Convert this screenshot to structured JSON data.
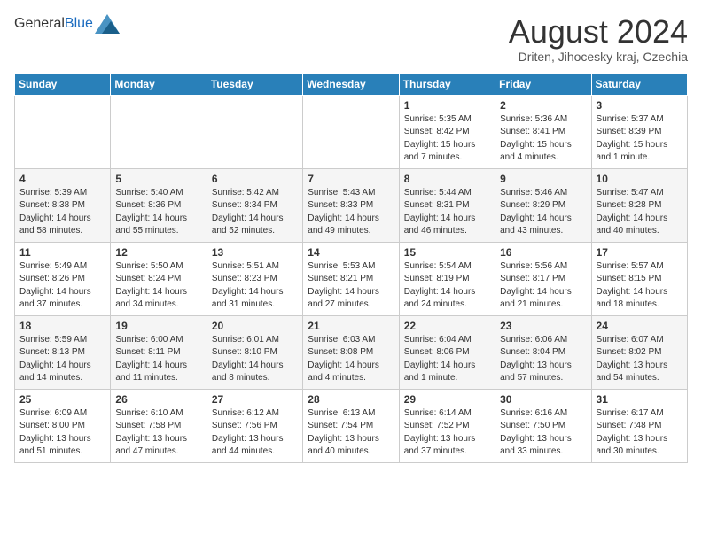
{
  "header": {
    "logo_general": "General",
    "logo_blue": "Blue",
    "month_title": "August 2024",
    "location": "Driten, Jihocesky kraj, Czechia"
  },
  "weekdays": [
    "Sunday",
    "Monday",
    "Tuesday",
    "Wednesday",
    "Thursday",
    "Friday",
    "Saturday"
  ],
  "weeks": [
    [
      {
        "day": "",
        "info": ""
      },
      {
        "day": "",
        "info": ""
      },
      {
        "day": "",
        "info": ""
      },
      {
        "day": "",
        "info": ""
      },
      {
        "day": "1",
        "info": "Sunrise: 5:35 AM\nSunset: 8:42 PM\nDaylight: 15 hours and 7 minutes."
      },
      {
        "day": "2",
        "info": "Sunrise: 5:36 AM\nSunset: 8:41 PM\nDaylight: 15 hours and 4 minutes."
      },
      {
        "day": "3",
        "info": "Sunrise: 5:37 AM\nSunset: 8:39 PM\nDaylight: 15 hours and 1 minute."
      }
    ],
    [
      {
        "day": "4",
        "info": "Sunrise: 5:39 AM\nSunset: 8:38 PM\nDaylight: 14 hours and 58 minutes."
      },
      {
        "day": "5",
        "info": "Sunrise: 5:40 AM\nSunset: 8:36 PM\nDaylight: 14 hours and 55 minutes."
      },
      {
        "day": "6",
        "info": "Sunrise: 5:42 AM\nSunset: 8:34 PM\nDaylight: 14 hours and 52 minutes."
      },
      {
        "day": "7",
        "info": "Sunrise: 5:43 AM\nSunset: 8:33 PM\nDaylight: 14 hours and 49 minutes."
      },
      {
        "day": "8",
        "info": "Sunrise: 5:44 AM\nSunset: 8:31 PM\nDaylight: 14 hours and 46 minutes."
      },
      {
        "day": "9",
        "info": "Sunrise: 5:46 AM\nSunset: 8:29 PM\nDaylight: 14 hours and 43 minutes."
      },
      {
        "day": "10",
        "info": "Sunrise: 5:47 AM\nSunset: 8:28 PM\nDaylight: 14 hours and 40 minutes."
      }
    ],
    [
      {
        "day": "11",
        "info": "Sunrise: 5:49 AM\nSunset: 8:26 PM\nDaylight: 14 hours and 37 minutes."
      },
      {
        "day": "12",
        "info": "Sunrise: 5:50 AM\nSunset: 8:24 PM\nDaylight: 14 hours and 34 minutes."
      },
      {
        "day": "13",
        "info": "Sunrise: 5:51 AM\nSunset: 8:23 PM\nDaylight: 14 hours and 31 minutes."
      },
      {
        "day": "14",
        "info": "Sunrise: 5:53 AM\nSunset: 8:21 PM\nDaylight: 14 hours and 27 minutes."
      },
      {
        "day": "15",
        "info": "Sunrise: 5:54 AM\nSunset: 8:19 PM\nDaylight: 14 hours and 24 minutes."
      },
      {
        "day": "16",
        "info": "Sunrise: 5:56 AM\nSunset: 8:17 PM\nDaylight: 14 hours and 21 minutes."
      },
      {
        "day": "17",
        "info": "Sunrise: 5:57 AM\nSunset: 8:15 PM\nDaylight: 14 hours and 18 minutes."
      }
    ],
    [
      {
        "day": "18",
        "info": "Sunrise: 5:59 AM\nSunset: 8:13 PM\nDaylight: 14 hours and 14 minutes."
      },
      {
        "day": "19",
        "info": "Sunrise: 6:00 AM\nSunset: 8:11 PM\nDaylight: 14 hours and 11 minutes."
      },
      {
        "day": "20",
        "info": "Sunrise: 6:01 AM\nSunset: 8:10 PM\nDaylight: 14 hours and 8 minutes."
      },
      {
        "day": "21",
        "info": "Sunrise: 6:03 AM\nSunset: 8:08 PM\nDaylight: 14 hours and 4 minutes."
      },
      {
        "day": "22",
        "info": "Sunrise: 6:04 AM\nSunset: 8:06 PM\nDaylight: 14 hours and 1 minute."
      },
      {
        "day": "23",
        "info": "Sunrise: 6:06 AM\nSunset: 8:04 PM\nDaylight: 13 hours and 57 minutes."
      },
      {
        "day": "24",
        "info": "Sunrise: 6:07 AM\nSunset: 8:02 PM\nDaylight: 13 hours and 54 minutes."
      }
    ],
    [
      {
        "day": "25",
        "info": "Sunrise: 6:09 AM\nSunset: 8:00 PM\nDaylight: 13 hours and 51 minutes."
      },
      {
        "day": "26",
        "info": "Sunrise: 6:10 AM\nSunset: 7:58 PM\nDaylight: 13 hours and 47 minutes."
      },
      {
        "day": "27",
        "info": "Sunrise: 6:12 AM\nSunset: 7:56 PM\nDaylight: 13 hours and 44 minutes."
      },
      {
        "day": "28",
        "info": "Sunrise: 6:13 AM\nSunset: 7:54 PM\nDaylight: 13 hours and 40 minutes."
      },
      {
        "day": "29",
        "info": "Sunrise: 6:14 AM\nSunset: 7:52 PM\nDaylight: 13 hours and 37 minutes."
      },
      {
        "day": "30",
        "info": "Sunrise: 6:16 AM\nSunset: 7:50 PM\nDaylight: 13 hours and 33 minutes."
      },
      {
        "day": "31",
        "info": "Sunrise: 6:17 AM\nSunset: 7:48 PM\nDaylight: 13 hours and 30 minutes."
      }
    ]
  ]
}
